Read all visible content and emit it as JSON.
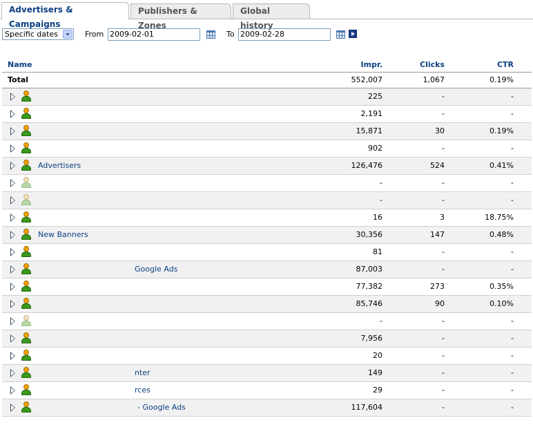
{
  "tabs": [
    {
      "label": "Advertisers & Campaigns",
      "active": true
    },
    {
      "label": "Publishers & Zones",
      "active": false
    },
    {
      "label": "Global history",
      "active": false
    }
  ],
  "controls": {
    "period_selected": "Specific dates",
    "from_label": "From",
    "from_value": "2009-02-01",
    "to_label": "To",
    "to_value": "2009-02-28"
  },
  "table": {
    "headers": {
      "name": "Name",
      "impr": "Impr.",
      "clicks": "Clicks",
      "ctr": "CTR"
    },
    "total": {
      "name": "Total",
      "impr": "552,007",
      "clicks": "1,067",
      "ctr": "0.19%"
    },
    "rows": [
      {
        "name": "",
        "impr": "225",
        "clicks": "-",
        "ctr": "-",
        "active": true
      },
      {
        "name": "",
        "impr": "2,191",
        "clicks": "-",
        "ctr": "-",
        "active": true
      },
      {
        "name": "",
        "impr": "15,871",
        "clicks": "30",
        "ctr": "0.19%",
        "active": true
      },
      {
        "name": "",
        "impr": "902",
        "clicks": "-",
        "ctr": "-",
        "active": true
      },
      {
        "name": "Advertisers",
        "impr": "126,476",
        "clicks": "524",
        "ctr": "0.41%",
        "active": true
      },
      {
        "name": "",
        "impr": "-",
        "clicks": "-",
        "ctr": "-",
        "active": false
      },
      {
        "name": "",
        "impr": "-",
        "clicks": "-",
        "ctr": "-",
        "active": false
      },
      {
        "name": "",
        "impr": "16",
        "clicks": "3",
        "ctr": "18.75%",
        "active": true
      },
      {
        "name": "New Banners",
        "impr": "30,356",
        "clicks": "147",
        "ctr": "0.48%",
        "active": true
      },
      {
        "name": "",
        "impr": "81",
        "clicks": "-",
        "ctr": "-",
        "active": true
      },
      {
        "name": "Google Ads",
        "impr": "87,003",
        "clicks": "-",
        "ctr": "-",
        "active": true
      },
      {
        "name": "",
        "impr": "77,382",
        "clicks": "273",
        "ctr": "0.35%",
        "active": true
      },
      {
        "name": "",
        "impr": "85,746",
        "clicks": "90",
        "ctr": "0.10%",
        "active": true
      },
      {
        "name": "",
        "impr": "-",
        "clicks": "-",
        "ctr": "-",
        "active": false
      },
      {
        "name": "",
        "impr": "7,956",
        "clicks": "-",
        "ctr": "-",
        "active": true
      },
      {
        "name": "",
        "impr": "20",
        "clicks": "-",
        "ctr": "-",
        "active": true
      },
      {
        "name": "nter",
        "impr": "149",
        "clicks": "-",
        "ctr": "-",
        "active": true
      },
      {
        "name": "rces",
        "impr": "29",
        "clicks": "-",
        "ctr": "-",
        "active": true
      },
      {
        "name": "- Google Ads",
        "impr": "117,604",
        "clicks": "-",
        "ctr": "-",
        "active": true
      }
    ]
  }
}
